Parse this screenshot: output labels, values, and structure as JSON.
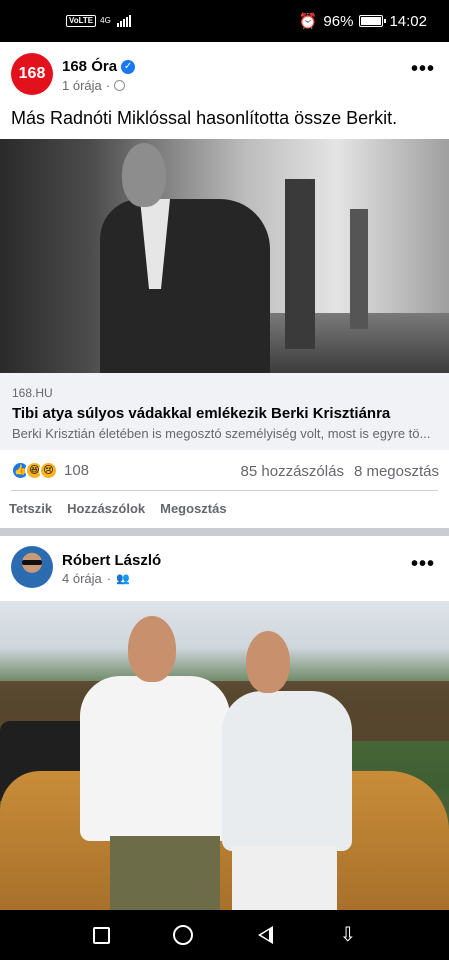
{
  "status_bar": {
    "network_badge": "VoLTE",
    "network_type": "4G",
    "battery": "96%",
    "time": "14:02"
  },
  "post1": {
    "page_name": "168 Óra",
    "avatar_text": "168",
    "time": "1 órája",
    "text": "Más Radnóti Miklóssal hasonlította össze Berkit.",
    "link": {
      "domain": "168.HU",
      "title": "Tibi atya súlyos vádakkal emlékezik Berki Krisztiánra",
      "description": "Berki Krisztián életében is megosztó személyiség volt, most is egyre tö..."
    },
    "reactions_count": "108",
    "comments": "85 hozzászólás",
    "shares": "8 megosztás",
    "actions": {
      "like": "Tetszik",
      "comment": "Hozzászólok",
      "share": "Megosztás"
    }
  },
  "post2": {
    "author": "Róbert László",
    "time": "4 órája"
  },
  "icons": [
    "verified-icon",
    "globe-icon",
    "more-icon",
    "like-reaction-icon",
    "haha-reaction-icon",
    "sad-reaction-icon",
    "friends-icon",
    "alarm-icon"
  ],
  "colors": {
    "brand_red": "#e3111c",
    "facebook_blue": "#1877f2",
    "secondary_text": "#65676b"
  }
}
